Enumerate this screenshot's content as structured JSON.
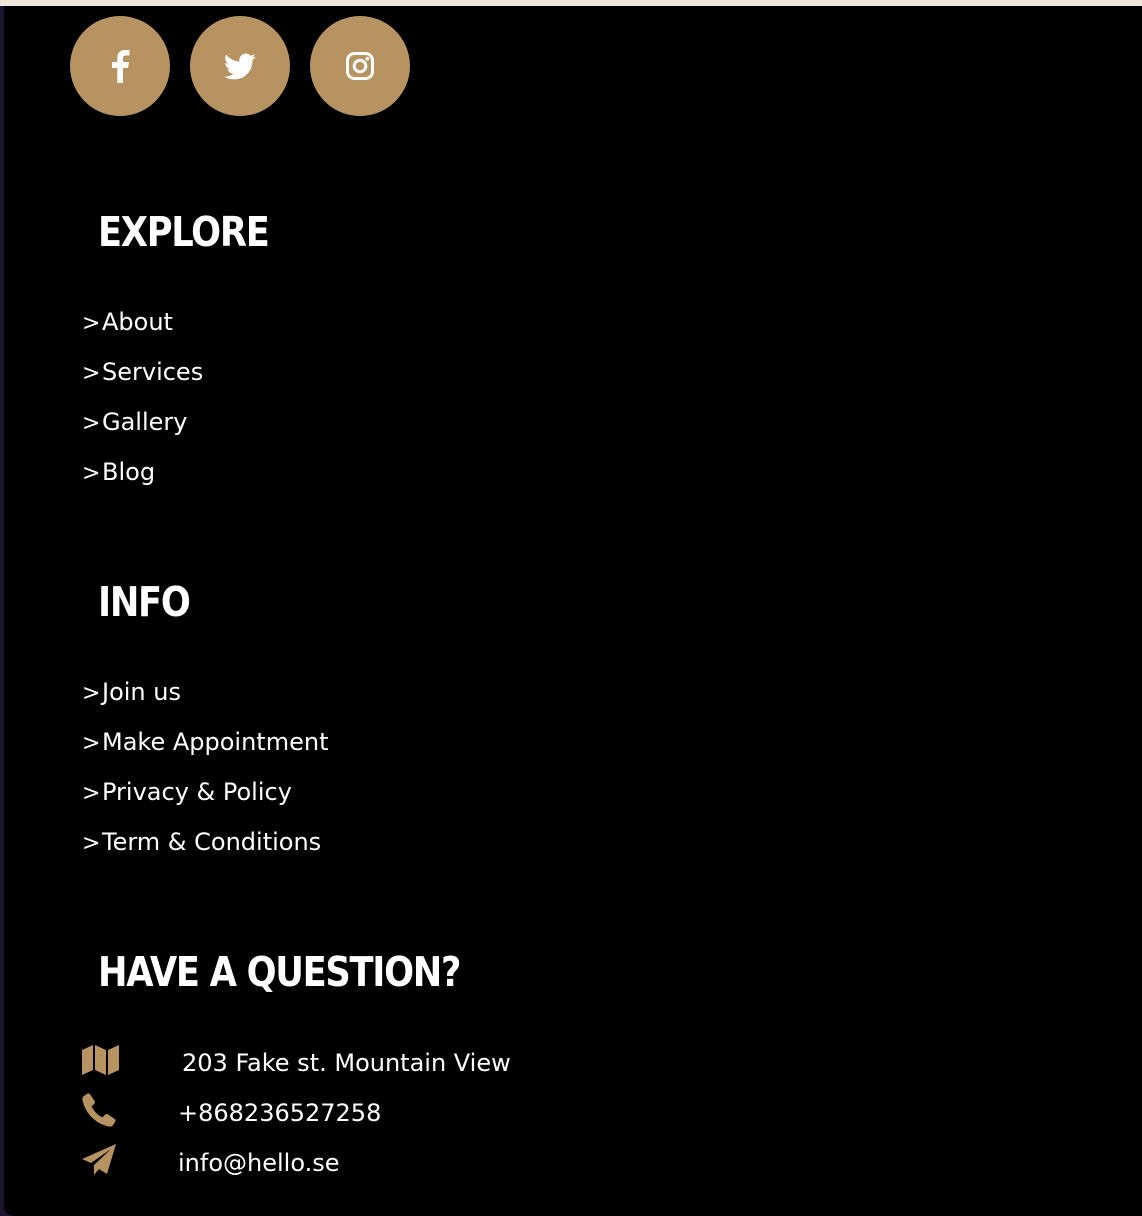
{
  "colors": {
    "accent": "#b79362",
    "background": "#000000",
    "text": "#ffffff",
    "top_strip": "#ede6da"
  },
  "socials": [
    {
      "icon": "facebook-icon"
    },
    {
      "icon": "twitter-icon"
    },
    {
      "icon": "instagram-icon"
    }
  ],
  "explore": {
    "title": "EXPLORE",
    "items": [
      {
        "label": "About"
      },
      {
        "label": "Services"
      },
      {
        "label": "Gallery"
      },
      {
        "label": "Blog"
      }
    ]
  },
  "info": {
    "title": "INFO",
    "items": [
      {
        "label": "Join us"
      },
      {
        "label": "Make Appointment"
      },
      {
        "label": "Privacy & Policy"
      },
      {
        "label": "Term & Conditions"
      }
    ]
  },
  "contact": {
    "title": "HAVE A QUESTION?",
    "address": {
      "icon": "map-icon",
      "text": "203 Fake st. Mountain View"
    },
    "phone": {
      "icon": "phone-icon",
      "text": "+868236527258"
    },
    "email": {
      "icon": "paper-plane-icon",
      "text": "info@hello.se"
    }
  }
}
